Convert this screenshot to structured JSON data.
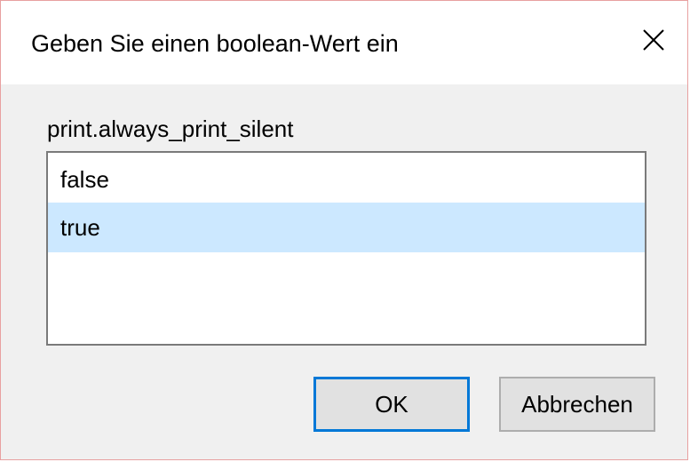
{
  "dialog": {
    "title": "Geben Sie einen boolean-Wert ein",
    "close_icon": "close-icon",
    "prompt": "print.always_print_silent",
    "options": [
      {
        "label": "false",
        "selected": false
      },
      {
        "label": "true",
        "selected": true
      }
    ],
    "ok_label": "OK",
    "cancel_label": "Abbrechen"
  },
  "colors": {
    "selection": "#cce8ff",
    "focus_border": "#0078d7",
    "button_face": "#e1e1e1",
    "dialog_bg": "#f0f0f0",
    "window_border": "#e8a0a0"
  }
}
